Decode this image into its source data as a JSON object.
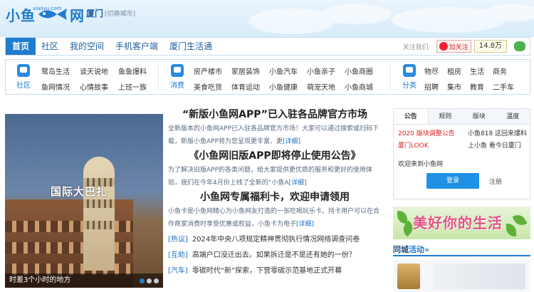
{
  "header": {
    "logo_text_left": "小鱼",
    "logo_site": "xiaoyu.com",
    "logo_text_right": "网",
    "city": "厦门",
    "city_switch": "[切换城市]"
  },
  "nav": {
    "items": [
      {
        "label": "首页",
        "active": true
      },
      {
        "label": "社区"
      },
      {
        "label": "我的空间"
      },
      {
        "label": "手机客户端"
      },
      {
        "label": "厦门生活通"
      }
    ],
    "follow_label": "关注我们:",
    "weibo_label": "加关注",
    "follower_count": "14.8万"
  },
  "categories": [
    {
      "title": "社区",
      "icon": "chat-icon",
      "links": [
        "鹭岛生活",
        "谈天说地",
        "鱼鱼爆料",
        "鱼网情况",
        "心情故事",
        "上班一族"
      ]
    },
    {
      "title": "消费",
      "icon": "shopping-icon",
      "links": [
        "房产楼市",
        "家居装饰",
        "小鱼汽车",
        "小鱼亲子",
        "小鱼商圈",
        "美食吃货",
        "体育运动",
        "小鱼健康",
        "萌宠天地",
        "小鱼商城"
      ]
    },
    {
      "title": "分类",
      "icon": "classify-icon",
      "links": [
        "物尽",
        "租房",
        "生活",
        "商务",
        "招聘",
        "集市",
        "教育",
        "二手车"
      ]
    }
  ],
  "feature": {
    "sign_text": "国际大巴扎",
    "caption": "时差3个小时的地方",
    "dots": 3
  },
  "news": {
    "items": [
      {
        "headline": "“新版小鱼网APP”已入驻各品牌官方市场",
        "summary": "全新版本的小鱼网APP已入驻各品牌官方市场！大家可以通过搜索或扫码下载，新版小鱼APP将为您呈现更丰富、更",
        "more": "[详细]"
      },
      {
        "headline": "《小鱼网旧版APP即将停止使用公告》",
        "summary": "为了解决旧版APP的各类问题，给大家提供更优质的服务和更好的使用体验，我们在今年4月份上线了全新的“小鱼A",
        "more": "[详细]"
      },
      {
        "headline": "小鱼网专属福利卡，欢迎申请领用",
        "summary": "小鱼卡是小鱼网精心为小鱼网友打造的一张吃喝玩乐卡。持卡用户可以在合作商家消费时享受优惠或权益，小鱼卡为电子",
        "more": "[详细]"
      }
    ],
    "list": [
      {
        "tag": "[热议]",
        "text": "2024年中央八项规定精神贯彻执行情况网络调查问卷"
      },
      {
        "tag": "[互助]",
        "text": "高端户口没迁出去。如果拆迁是不是还有她的一份？"
      },
      {
        "tag": "[汽车]",
        "text": "零碳时代“新”探索，下营零碳示范基地正式开幕"
      }
    ]
  },
  "side_panel": {
    "tabs": [
      {
        "label": "公告",
        "active": true
      },
      {
        "label": "规则"
      },
      {
        "label": "版块"
      },
      {
        "label": "温度"
      }
    ],
    "announcements": [
      {
        "text": "2020 版块调整公告",
        "red": true
      },
      {
        "text": "小鱼818 这回来爆料",
        "red": false
      },
      {
        "text": "厦门LOOK",
        "red": true
      },
      {
        "text": "上小鱼 看今日厦门",
        "red": false
      }
    ],
    "welcome": "欢迎来到小鱼网",
    "login_label": "登录",
    "register_label": "注册"
  },
  "banner": {
    "text": "美好你的生活"
  },
  "activity": {
    "title_left": "同城",
    "title_right": "活动»"
  },
  "colors": {
    "brand_blue": "#1f7ccf",
    "alert_red": "#dd2222",
    "login_blue": "#1e90e6"
  }
}
